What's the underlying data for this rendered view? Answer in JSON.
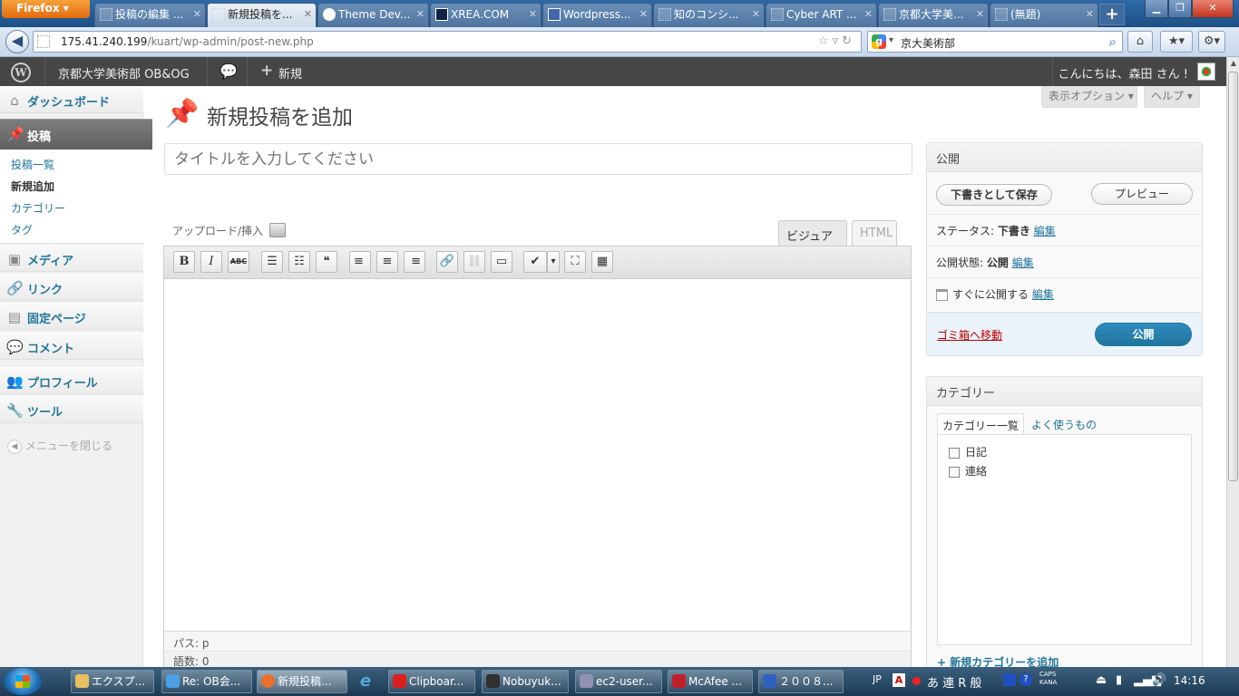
{
  "browser": {
    "menu_button": "Firefox",
    "tabs": [
      {
        "label": "投稿の編集 ...",
        "active": false
      },
      {
        "label": "新規投稿を...",
        "active": true
      },
      {
        "label": "Theme Dev...",
        "active": false
      },
      {
        "label": "XREA.COM",
        "active": false
      },
      {
        "label": "Wordpress...",
        "active": false
      },
      {
        "label": "知のコンシ...",
        "active": false
      },
      {
        "label": "Cyber ART ...",
        "active": false
      },
      {
        "label": "京都大学美...",
        "active": false
      },
      {
        "label": "(無題)",
        "active": false
      }
    ],
    "new_tab_label": "+",
    "url_host": "175.41.240.199",
    "url_path": "/kuart/wp-admin/post-new.php",
    "search_engine_letter": "g",
    "search_text": "京大美術部"
  },
  "adminbar": {
    "site_name": "京都大学美術部 OB&OG",
    "new_label": "新規",
    "howdy": "こんにちは、森田 さん !"
  },
  "menu": {
    "dashboard": "ダッシュボード",
    "posts": "投稿",
    "submenu": [
      "投稿一覧",
      "新規追加",
      "カテゴリー",
      "タグ"
    ],
    "media": "メディア",
    "links": "リンク",
    "pages": "固定ページ",
    "comments": "コメント",
    "profile": "プロフィール",
    "tools": "ツール",
    "collapse": "メニューを閉じる"
  },
  "header": {
    "screen_options": "表示オプション ▾",
    "help": "ヘルプ ▾",
    "title": "新規投稿を追加"
  },
  "editor": {
    "title_placeholder": "タイトルを入力してください",
    "upload_insert": "アップロード/挿入",
    "tab_visual": "ビジュアル",
    "tab_html": "HTML",
    "toolbar": {
      "bold": "B",
      "italic": "I",
      "strike": "ABC",
      "bullets": "☰",
      "numbers": "☷",
      "quote": "❝",
      "align_left": "≡",
      "align_center": "≡",
      "align_right": "≡",
      "link": "🔗",
      "unlink": "⛓",
      "more": "▭",
      "spell": "✔",
      "spell_caret": "▾",
      "fullscreen": "⛶",
      "kitchen_sink": "▦"
    },
    "path_label": "パス:",
    "path_value": "p",
    "word_count_label": "語数:",
    "word_count": "0"
  },
  "publish": {
    "heading": "公開",
    "save_draft": "下書きとして保存",
    "preview": "プレビュー",
    "status_label": "ステータス:",
    "status_value": "下書き",
    "visibility_label": "公開状態:",
    "visibility_value": "公開",
    "schedule_text": "すぐに公開する",
    "edit": "編集",
    "trash": "ゴミ箱へ移動",
    "publish": "公開"
  },
  "categories": {
    "heading": "カテゴリー",
    "tab_all": "カテゴリー一覧",
    "tab_popular": "よく使うもの",
    "items": [
      "日記",
      "連絡"
    ],
    "add_new": "+ 新規カテゴリーを追加"
  },
  "taskbar": {
    "tasks": [
      {
        "label": "エクスプ...",
        "color": "#e8c060"
      },
      {
        "label": "Re: OB会...",
        "color": "#4aa0e0"
      },
      {
        "label": "新規投稿...",
        "color": "#e8702a"
      },
      {
        "label": "Clipboar...",
        "color": "#d82020"
      },
      {
        "label": "Nobuyuk...",
        "color": "#303030"
      },
      {
        "label": "ec2-user...",
        "color": "#9090b0"
      },
      {
        "label": "McAfee ...",
        "color": "#c0202a"
      },
      {
        "label": "２００８...",
        "color": "#3060c0"
      }
    ],
    "tray": {
      "lang": "JP",
      "ime": "あ 連 R 般",
      "caps": "CAPS",
      "kana": "KANA",
      "clock": "14:16"
    }
  }
}
